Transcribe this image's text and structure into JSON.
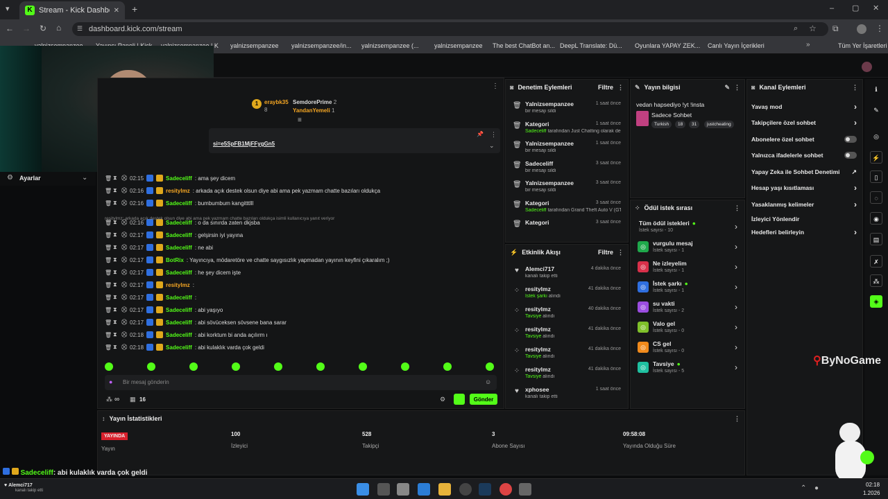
{
  "browser": {
    "tab_title": "Stream - Kick Dashboard",
    "url": "dashboard.kick.com/stream",
    "bookmarks": [
      "yalnizsempanzee",
      "Yayıncı Paneli | Kick",
      "yalnizsempanzee | K",
      "yalnizsempanzee",
      "yalnizsempanzee/in...",
      "yalnizsempanzee (...",
      "yalnizsempanzee",
      "The best ChatBot an...",
      "DeepL Translate: Dü...",
      "Oyunlara YAPAY ZEK...",
      "Canlı Yayın İçerikleri"
    ],
    "all_bookmarks": "Tüm Yer İşaretleri"
  },
  "left": {
    "settings": "Ayarlar"
  },
  "chat": {
    "top_users": [
      {
        "name": "eraybk35",
        "count": "8",
        "rank": "1"
      },
      {
        "name": "SemdorePrime",
        "count": "2"
      },
      {
        "name": "YandanYemeli",
        "count": "1"
      }
    ],
    "pinned": "si=e5SpFB1MjFFygGn5",
    "lines": [
      {
        "time": "02:15",
        "user": "Sadeceliff",
        "color": "#53fc18",
        "msg": ": ama şey dicem"
      },
      {
        "time": "02:16",
        "user": "resitylmz",
        "color": "#f5a623",
        "msg": ": arkada açık destek olsun diye abi ama pek yazmam chatte bazıları oldukça"
      },
      {
        "time": "02:16",
        "user": "Sadeceliff",
        "color": "#53fc18",
        "msg": ": bumbumbum kangitttlll"
      },
      {
        "time": "02:16",
        "user": "Sadeceliff",
        "color": "#53fc18",
        "msg": ": o da sınırda zaten dkjsba"
      },
      {
        "time": "02:17",
        "user": "Sadeceliff",
        "color": "#53fc18",
        "msg": ": gelşirsin iyi yayına"
      },
      {
        "time": "02:17",
        "user": "Sadeceliff",
        "color": "#53fc18",
        "msg": ": ne abi"
      },
      {
        "time": "02:17",
        "user": "BotRix",
        "color": "#53fc18",
        "msg": ": Yayıncıya, mödaretöre ve chatte saygısızlık yapmadan yayının keyfini çıkaralım ;)"
      },
      {
        "time": "02:17",
        "user": "Sadeceliff",
        "color": "#53fc18",
        "msg": ": he şey dicem işte"
      },
      {
        "time": "02:17",
        "user": "resitylmz",
        "color": "#f5a623",
        "msg": ":"
      },
      {
        "time": "02:17",
        "user": "Sadeceliff",
        "color": "#53fc18",
        "msg": ":"
      },
      {
        "time": "02:17",
        "user": "Sadeceliff",
        "color": "#53fc18",
        "msg": ": abi yaşıyo"
      },
      {
        "time": "02:17",
        "user": "Sadeceliff",
        "color": "#53fc18",
        "msg": ": abi sövüceksen sövsene bana sarar"
      },
      {
        "time": "02:18",
        "user": "Sadeceliff",
        "color": "#53fc18",
        "msg": ": abi korktum bi anda açılırm ı"
      },
      {
        "time": "02:18",
        "user": "Sadeceliff",
        "color": "#53fc18",
        "msg": ": abi kulaklık varda çok geldi"
      }
    ],
    "reply_note": "resitylmz: arkada açık destek olsun diye abi ama pek yazmam chatte bazıları oldukça isimli kullanıcıya yanıt veriyor",
    "input_placeholder": "Bir mesaj gönderin",
    "viewers_small": "∞",
    "count_small": "16",
    "send": "Gönder"
  },
  "mod_actions": {
    "title": "Denetim Eylemleri",
    "filter": "Filtre",
    "items": [
      {
        "title": "Yalnizsempanzee",
        "desc": "bir mesajı sildi",
        "time": "1 saat önce"
      },
      {
        "title": "Kategori",
        "desc_user": "Sadeceliff",
        "desc": " tarafından Just Chatting olarak değiştirildi",
        "time": "1 saat önce"
      },
      {
        "title": "Yalnizsempanzee",
        "desc": "bir mesajı sildi",
        "time": "1 saat önce"
      },
      {
        "title": "Sadeceliff",
        "desc": "bir mesajı sildi",
        "time": "3 saat önce"
      },
      {
        "title": "Yalnizsempanzee",
        "desc": "bir mesajı sildi",
        "time": "3 saat önce"
      },
      {
        "title": "Kategori",
        "desc_user": "Sadeceliff",
        "desc": " tarafından Grand Theft Auto V (GTA) olarak değiştirildi",
        "time": "3 saat önce"
      },
      {
        "title": "Kategori",
        "desc_user": "",
        "desc": "",
        "time": "3 saat önce"
      }
    ]
  },
  "activity": {
    "title": "Etkinlik Akışı",
    "filter": "Filtre",
    "items": [
      {
        "title": "Alemci717",
        "desc": "kanalı takip etti",
        "time": "4 dakika önce"
      },
      {
        "title": "resitylmz",
        "desc_green": "İstek şarkı",
        "desc": " alındı",
        "time": "41 dakika önce"
      },
      {
        "title": "resitylmz",
        "desc_green": "Tavsiye",
        "desc": " alındı",
        "time": "40 dakika önce"
      },
      {
        "title": "resitylmz",
        "desc_green": "Tavsiye",
        "desc": " alındı",
        "time": "41 dakika önce"
      },
      {
        "title": "resitylmz",
        "desc_green": "Tavsiye",
        "desc": " alındı",
        "time": "41 dakika önce"
      },
      {
        "title": "resitylmz",
        "desc_green": "Tavsiye",
        "desc": " alındı",
        "time": "41 dakika önce"
      },
      {
        "title": "xphosee",
        "desc": "kanalı takip etti",
        "time": "1 saat önce"
      }
    ]
  },
  "stream_info": {
    "title": "Yayın bilgisi",
    "stream_title": "vedan hapsediyo !yt !insta",
    "category": "Sadece Sohbet",
    "tags": [
      "Turkish",
      "18",
      "31",
      "justcheating"
    ]
  },
  "rewards": {
    "title": "Ödül istek sırası",
    "items": [
      {
        "name": "Tüm ödül istekleri",
        "count": "İstek sayısı - 10",
        "color": "",
        "dot": true
      },
      {
        "name": "vurgulu mesaj",
        "count": "İstek sayısı - 1",
        "color": "#1fa84b",
        "dot": false
      },
      {
        "name": "Ne izleyelim",
        "count": "İstek sayısı - 1",
        "color": "#d8304a",
        "dot": false
      },
      {
        "name": "İstek şarkı",
        "count": "İstek sayısı - 1",
        "color": "#2f6fe0",
        "dot": true
      },
      {
        "name": "su vakti",
        "count": "İstek sayısı - 2",
        "color": "#9b4de0",
        "dot": false
      },
      {
        "name": "Valo gel",
        "count": "İstek sayısı - 0",
        "color": "#7fc02a",
        "dot": false
      },
      {
        "name": "CS gel",
        "count": "İstek sayısı - 0",
        "color": "#f08a1c",
        "dot": false
      },
      {
        "name": "Tavsiye",
        "count": "İstek sayısı - 5",
        "color": "#1fc0a0",
        "dot": true
      }
    ]
  },
  "channel_actions": {
    "title": "Kanal Eylemleri",
    "items": [
      {
        "label": "Yavaş mod",
        "ctrl": "arrow"
      },
      {
        "label": "Takipçilere özel sohbet",
        "ctrl": "arrow"
      },
      {
        "label": "Abonelere özel sohbet",
        "ctrl": "toggle"
      },
      {
        "label": "Yalnızca ifadelerle sohbet",
        "ctrl": "toggle"
      },
      {
        "label": "Yapay Zeka ile Sohbet Denetimi",
        "ctrl": "link"
      },
      {
        "label": "Hesap yaşı kısıtlaması",
        "ctrl": "arrow"
      },
      {
        "label": "Yasaklanmış kelimeler",
        "ctrl": "arrow"
      },
      {
        "label": "İzleyici Yönlendir",
        "ctrl": "none"
      },
      {
        "label": "Hedefleri belirleyin",
        "ctrl": "arrow"
      }
    ]
  },
  "stats": {
    "title": "Yayın İstatistikleri",
    "live_badge": "YAYINDA",
    "live_label": "Yayın",
    "viewers": "100",
    "viewers_label": "İzleyici",
    "followers": "528",
    "followers_label": "Takipçi",
    "subs": "3",
    "subs_label": "Abone Sayısı",
    "uptime": "09:58:08",
    "uptime_label": "Yayında Olduğu Süre"
  },
  "overlay": {
    "alert_user": "Sadeceliff",
    "alert_msg": ": abi kulaklık varda çok geldi",
    "bynogame": "ByNoGame",
    "follow_user": "Alemci717",
    "follow_text": "kanalı takip etti"
  },
  "taskbar": {
    "clock": "02:18",
    "date": "1.2026"
  }
}
